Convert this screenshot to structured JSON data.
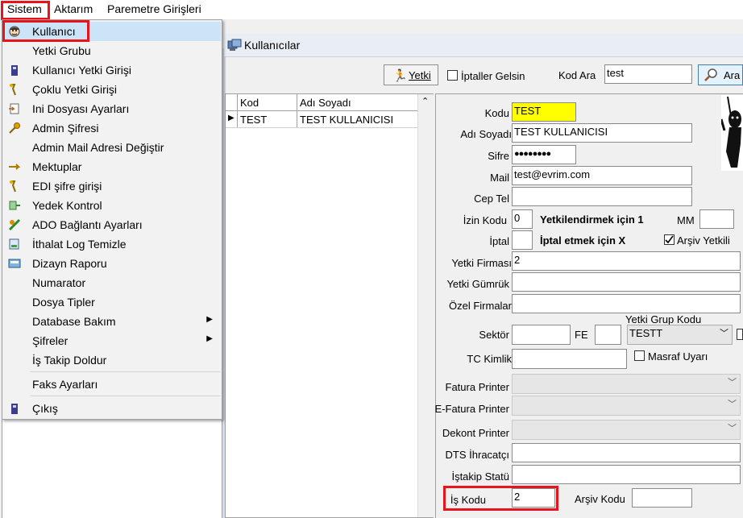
{
  "menubar": {
    "items": [
      "Sistem",
      "Aktarım",
      "Paremetre Girişleri"
    ]
  },
  "menu": {
    "items": [
      {
        "label": "Kullanıcı",
        "icon": "user-face-icon",
        "submenu": false
      },
      {
        "label": "Yetki Grubu",
        "icon": "",
        "submenu": false
      },
      {
        "label": "Kullanıcı Yetki Girişi",
        "icon": "user-bar-icon",
        "submenu": false
      },
      {
        "label": "Çoklu Yetki Girişi",
        "icon": "multi-key-icon",
        "submenu": false
      },
      {
        "label": "Ini Dosyası  Ayarları",
        "icon": "ini-file-icon",
        "submenu": false
      },
      {
        "label": "Admin Şifresi",
        "icon": "key-icon",
        "submenu": false
      },
      {
        "label": "Admin Mail Adresi Değiştir",
        "icon": "",
        "submenu": false
      },
      {
        "label": "Mektuplar",
        "icon": "letter-icon",
        "submenu": false
      },
      {
        "label": "EDI şifre girişi",
        "icon": "edi-key-icon",
        "submenu": false
      },
      {
        "label": "Yedek Kontrol",
        "icon": "backup-icon",
        "submenu": false
      },
      {
        "label": "ADO Bağlantı Ayarları",
        "icon": "ado-connection-icon",
        "submenu": false
      },
      {
        "label": "İthalat Log Temizle",
        "icon": "log-clean-icon",
        "submenu": false
      },
      {
        "label": "Dizayn Raporu",
        "icon": "report-design-icon",
        "submenu": false
      },
      {
        "label": "Numarator",
        "icon": "",
        "submenu": false
      },
      {
        "label": "Dosya Tipler",
        "icon": "",
        "submenu": false
      },
      {
        "label": "Database Bakım",
        "icon": "",
        "submenu": true
      },
      {
        "label": "Şifreler",
        "icon": "",
        "submenu": true
      },
      {
        "label": "İş Takip Doldur",
        "icon": "",
        "submenu": false
      },
      {
        "label": "Faks Ayarları",
        "icon": "",
        "submenu": false
      },
      {
        "label": "Çıkış",
        "icon": "exit-icon",
        "submenu": false
      }
    ]
  },
  "window": {
    "title": "Kullanıcılar"
  },
  "toolbar": {
    "yetki_label": "Yetki",
    "iptaller_label": "İptaller Gelsin",
    "kod_ara_label": "Kod Ara",
    "kod_ara_value": "test",
    "ara_label": "Ara"
  },
  "grid": {
    "columns": [
      "Kod",
      "Adı Soyadı"
    ],
    "rows": [
      {
        "kod": "TEST",
        "adi": "TEST KULLANICISI"
      }
    ]
  },
  "form": {
    "kodu_label": "Kodu",
    "kodu_value": "TEST",
    "adi_label": "Adı Soyadı",
    "adi_value": "TEST KULLANICISI",
    "sifre_label": "Sifre",
    "sifre_value": "●●●●●●●●",
    "mail_label": "Mail",
    "mail_value": "test@evrim.com",
    "ceptel_label": "Cep Tel",
    "ceptel_value": "",
    "izin_label": "İzin Kodu",
    "izin_value": "0",
    "yetki_hint": "Yetkilendirmek için 1",
    "mm_label": "MM",
    "mm_value": "",
    "iptal_label": "İptal",
    "iptal_value": "",
    "iptal_hint": "İptal etmek için X",
    "arsiv_yetkili_label": "Arşiv Yetkili",
    "arsiv_yetkili_checked": true,
    "yetki_firmasi_label": "Yetki Firması",
    "yetki_firmasi_value": "2",
    "yetki_gumruk_label": "Yetki Gümrük",
    "yetki_gumruk_value": "",
    "ozel_firmalar_label": "Özel Firmalar",
    "ozel_firmalar_value": "",
    "yetki_grup_kodu_label": "Yetki Grup Kodu",
    "yetki_grup_kodu_value": "TESTT",
    "sektor_label": "Sektör",
    "sektor_value": "",
    "fe_label": "FE",
    "fe_value": "",
    "tc_label": "TC Kimlik",
    "tc_value": "",
    "masraf_label": "Masraf Uyarı",
    "fatura_printer_label": "Fatura Printer",
    "efatura_printer_label": "E-Fatura Printer",
    "dekont_printer_label": "Dekont Printer",
    "dts_label": "DTS İhracatçı",
    "dts_value": "",
    "istakip_label": "İştakip Statü",
    "istakip_value": "",
    "is_kodu_label": "İş Kodu",
    "is_kodu_value": "2",
    "arsiv_kodu_label": "Arşiv Kodu",
    "arsiv_kodu_value": ""
  },
  "colors": {
    "highlight": "#cce4f7",
    "required_field": "#ffff00",
    "annotation": "#e8141c"
  }
}
